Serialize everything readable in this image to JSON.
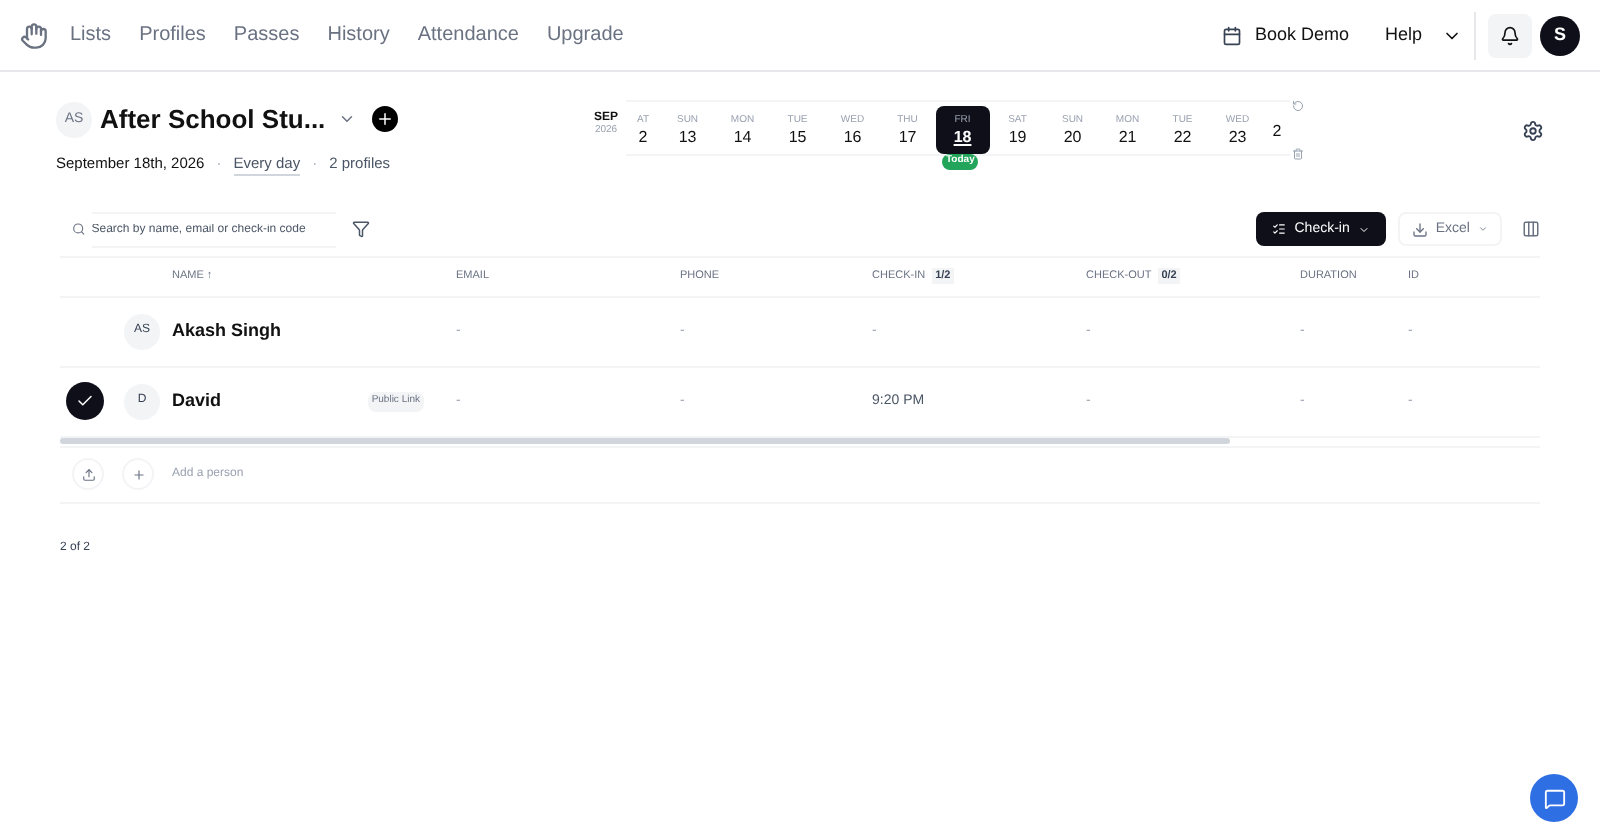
{
  "nav": {
    "links": [
      "Lists",
      "Profiles",
      "Passes",
      "History",
      "Attendance",
      "Upgrade"
    ],
    "book_demo": "Book Demo",
    "help": "Help",
    "user_initial": "S"
  },
  "list": {
    "initials": "AS",
    "title": "After School Stu...",
    "date": "September 18th, 2026",
    "recurrence": "Every day",
    "profiles": "2 profiles",
    "separator": "·"
  },
  "calendar": {
    "month": "SEP",
    "year": "2026",
    "today_label": "Today",
    "days": [
      {
        "dow": "AT",
        "day": "2",
        "selected": false
      },
      {
        "dow": "SUN",
        "day": "13",
        "selected": false
      },
      {
        "dow": "MON",
        "day": "14",
        "selected": false
      },
      {
        "dow": "TUE",
        "day": "15",
        "selected": false
      },
      {
        "dow": "WED",
        "day": "16",
        "selected": false
      },
      {
        "dow": "THU",
        "day": "17",
        "selected": false
      },
      {
        "dow": "FRI",
        "day": "18",
        "selected": true
      },
      {
        "dow": "SAT",
        "day": "19",
        "selected": false
      },
      {
        "dow": "SUN",
        "day": "20",
        "selected": false
      },
      {
        "dow": "MON",
        "day": "21",
        "selected": false
      },
      {
        "dow": "TUE",
        "day": "22",
        "selected": false
      },
      {
        "dow": "WED",
        "day": "23",
        "selected": false
      },
      {
        "day": "2",
        "selected": false
      }
    ]
  },
  "search": {
    "placeholder": "Search by name, email or check-in code"
  },
  "checkin_button": "Check-in",
  "excel_button": "Excel",
  "table": {
    "columns": [
      {
        "label": "NAME ↑"
      },
      {
        "label": "EMAIL"
      },
      {
        "label": "PHONE"
      },
      {
        "label": "CHECK-IN",
        "count": "1/2"
      },
      {
        "label": "CHECK-OUT",
        "count": "0/2"
      },
      {
        "label": "DURATION"
      },
      {
        "label": "ID"
      }
    ],
    "rows": [
      {
        "checked": false,
        "initials": "AS",
        "name": "Akash Singh",
        "email": "-",
        "phone": "-",
        "check_in": "-",
        "check_out": "-",
        "duration": "-",
        "id": "-"
      },
      {
        "checked": true,
        "initials": "D",
        "name": "David",
        "tag": "Public Link",
        "email": "-",
        "phone": "-",
        "check_in": "9:20 PM",
        "check_out": "-",
        "duration": "-",
        "id": "-"
      }
    ]
  },
  "add_person": "Add a person",
  "footer": "2 of 2"
}
